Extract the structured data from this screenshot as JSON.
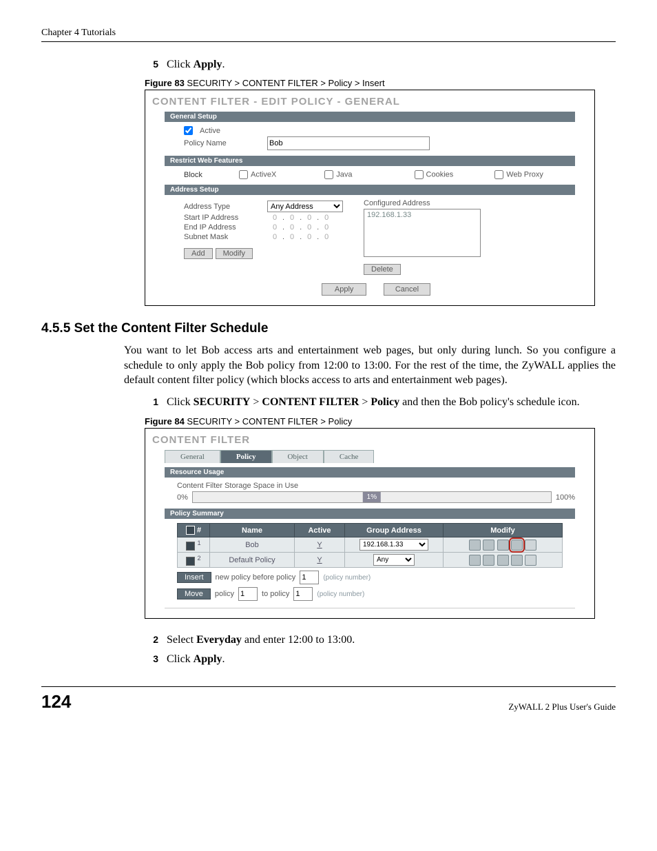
{
  "page": {
    "chapter_header": "Chapter 4 Tutorials",
    "page_number": "124",
    "footer_guide": "ZyWALL 2 Plus User's Guide"
  },
  "step5": {
    "num": "5",
    "text_a": "Click ",
    "bold": "Apply",
    "text_b": "."
  },
  "fig83": {
    "label": "Figure 83",
    "caption": "   SECURITY > CONTENT FILTER > Policy > Insert",
    "title": "CONTENT FILTER - EDIT POLICY - GENERAL",
    "general_setup_bar": "General Setup",
    "active_label": "Active",
    "policy_name_label": "Policy Name",
    "policy_name_value": "Bob",
    "restrict_bar": "Restrict Web Features",
    "block_label": "Block",
    "activex": "ActiveX",
    "java": "Java",
    "cookies": "Cookies",
    "webproxy": "Web Proxy",
    "address_bar": "Address Setup",
    "address_type_label": "Address Type",
    "address_type_value": "Any Address",
    "start_ip_label": "Start IP Address",
    "end_ip_label": "End IP Address",
    "subnet_label": "Subnet Mask",
    "ip_octet": "0",
    "configured_label": "Configured Address",
    "configured_value": "192.168.1.33",
    "add_btn": "Add",
    "modify_btn": "Modify",
    "delete_btn": "Delete",
    "apply_btn": "Apply",
    "cancel_btn": "Cancel"
  },
  "section455": {
    "heading": "4.5.5  Set the Content Filter Schedule",
    "para": "You want to let Bob access arts and entertainment web pages, but only during lunch. So you configure a schedule to only apply the Bob policy from 12:00 to 13:00. For the rest of the time, the ZyWALL applies the default content filter policy (which blocks access to arts and entertainment web pages).",
    "step1_num": "1",
    "step1_a": "Click ",
    "step1_b1": "SECURITY",
    "step1_gt1": " > ",
    "step1_b2": "CONTENT FILTER",
    "step1_gt2": " > ",
    "step1_b3": "Policy",
    "step1_c": " and then the Bob policy's schedule icon."
  },
  "fig84": {
    "label": "Figure 84",
    "caption": "   SECURITY > CONTENT FILTER > Policy",
    "title": "CONTENT FILTER",
    "tab_general": "General",
    "tab_policy": "Policy",
    "tab_object": "Object",
    "tab_cache": "Cache",
    "resource_bar": "Resource Usage",
    "storage_label": "Content Filter Storage Space in Use",
    "pct0": "0%",
    "pct1": "1%",
    "pct100": "100%",
    "summary_bar": "Policy Summary",
    "col_hash": "#",
    "col_name": "Name",
    "col_active": "Active",
    "col_group": "Group Address",
    "col_modify": "Modify",
    "row1_idx": "1",
    "row1_name": "Bob",
    "row1_active": "Y",
    "row1_addr": "192.168.1.33",
    "row2_idx": "2",
    "row2_name": "Default Policy",
    "row2_active": "Y",
    "row2_addr": "Any",
    "insert_btn": "Insert",
    "insert_label_a": "new policy before policy",
    "insert_val": "1",
    "insert_hint": "(policy number)",
    "move_btn": "Move",
    "move_label_a": "policy",
    "move_val1": "1",
    "move_label_b": "to policy",
    "move_val2": "1",
    "move_hint": "(policy number)"
  },
  "step2": {
    "num": "2",
    "a": "Select ",
    "bold": "Everyday",
    "b": " and enter 12:00 to 13:00."
  },
  "step3": {
    "num": "3",
    "a": "Click ",
    "bold": "Apply",
    "b": "."
  }
}
